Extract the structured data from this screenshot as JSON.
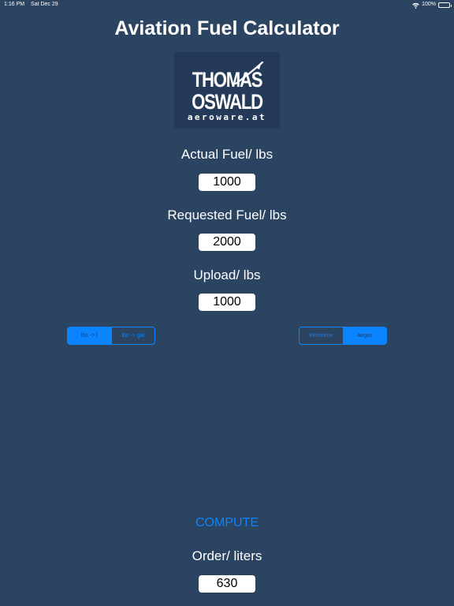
{
  "status_bar": {
    "time": "1:16 PM",
    "date": "Sat Dec 29",
    "battery": "100%"
  },
  "title": "Aviation Fuel Calculator",
  "logo": {
    "line1": "THOMAS",
    "line2": "OSWALD",
    "line3": "aeroware.at"
  },
  "fields": {
    "actual": {
      "label": "Actual Fuel/ lbs",
      "value": "1000"
    },
    "requested": {
      "label": "Requested Fuel/ lbs",
      "value": "2000"
    },
    "upload": {
      "label": "Upload/ lbs",
      "value": "1000"
    }
  },
  "unit_segment": {
    "options": [
      "lbs -> l",
      "lbs -> gal"
    ],
    "selected": "lbs -> l"
  },
  "fuel_segment": {
    "options": [
      "Kerosene",
      "Avgas"
    ],
    "selected": "Avgas"
  },
  "compute_label": "COMPUTE",
  "order": {
    "label": "Order/ liters",
    "value": "630"
  },
  "colors": {
    "background": "#2b4462",
    "accent": "#0a84ff"
  }
}
